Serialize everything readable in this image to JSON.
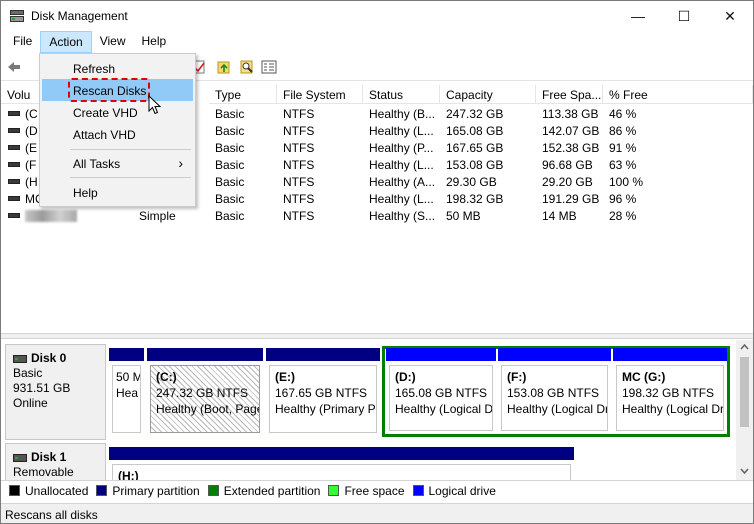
{
  "window": {
    "title": "Disk Management",
    "minimize_glyph": "—",
    "maximize_glyph": "☐",
    "close_glyph": "✕"
  },
  "menubar": {
    "items": [
      {
        "label": "File"
      },
      {
        "label": "Action",
        "active": true
      },
      {
        "label": "View"
      },
      {
        "label": "Help"
      }
    ]
  },
  "action_menu": {
    "items": [
      {
        "label": "Refresh"
      },
      {
        "label": "Rescan Disks",
        "hover": true
      },
      {
        "label": "Create VHD"
      },
      {
        "label": "Attach VHD"
      },
      {
        "label": "All Tasks",
        "submenu_glyph": "›"
      },
      {
        "label": "Help"
      }
    ]
  },
  "list": {
    "columns": [
      "Volu",
      "Type",
      "File System",
      "Status",
      "Capacity",
      "Free Spa...",
      "% Free"
    ],
    "rows": [
      {
        "volume": "(C",
        "layout": "",
        "type": "Basic",
        "fs": "NTFS",
        "status": "Healthy (B...",
        "capacity": "247.32 GB",
        "free": "113.38 GB",
        "pct": "46 %"
      },
      {
        "volume": "(D",
        "layout": "",
        "type": "Basic",
        "fs": "NTFS",
        "status": "Healthy (L...",
        "capacity": "165.08 GB",
        "free": "142.07 GB",
        "pct": "86 %"
      },
      {
        "volume": "(E",
        "layout": "",
        "type": "Basic",
        "fs": "NTFS",
        "status": "Healthy (P...",
        "capacity": "167.65 GB",
        "free": "152.38 GB",
        "pct": "91 %"
      },
      {
        "volume": "(F",
        "layout": "",
        "type": "Basic",
        "fs": "NTFS",
        "status": "Healthy (L...",
        "capacity": "153.08 GB",
        "free": "96.68 GB",
        "pct": "63 %"
      },
      {
        "volume": "(H",
        "layout": "",
        "type": "Basic",
        "fs": "NTFS",
        "status": "Healthy (A...",
        "capacity": "29.30 GB",
        "free": "29.20 GB",
        "pct": "100 %"
      },
      {
        "volume": "MC",
        "layout": "",
        "type": "Basic",
        "fs": "NTFS",
        "status": "Healthy (L...",
        "capacity": "198.32 GB",
        "free": "191.29 GB",
        "pct": "96 %"
      },
      {
        "volume": "",
        "layout": "Simple",
        "type": "Basic",
        "fs": "NTFS",
        "status": "Healthy (S...",
        "capacity": "50 MB",
        "free": "14 MB",
        "pct": "28 %"
      }
    ]
  },
  "disks": [
    {
      "name": "Disk 0",
      "type": "Basic",
      "size": "931.51 GB",
      "state": "Online",
      "partitions": [
        {
          "label": "",
          "line1": "50 M",
          "line2": "Hea"
        },
        {
          "label": "(C:)",
          "line1": "247.32 GB NTFS",
          "line2": "Healthy (Boot, Page"
        },
        {
          "label": "(E:)",
          "line1": "167.65 GB NTFS",
          "line2": "Healthy (Primary P"
        },
        {
          "label": "(D:)",
          "line1": "165.08 GB NTFS",
          "line2": "Healthy (Logical D"
        },
        {
          "label": "(F:)",
          "line1": "153.08 GB NTFS",
          "line2": "Healthy (Logical Dr"
        },
        {
          "label": "MC  (G:)",
          "line1": "198.32 GB NTFS",
          "line2": "Healthy (Logical Dr"
        }
      ]
    },
    {
      "name": "Disk 1",
      "type": "Removable",
      "partitions": [
        {
          "label": "(H:)"
        }
      ]
    }
  ],
  "legend": [
    {
      "label": "Unallocated",
      "color": "#000000"
    },
    {
      "label": "Primary partition",
      "color": "#000080"
    },
    {
      "label": "Extended partition",
      "color": "#008000"
    },
    {
      "label": "Free space",
      "color": "#33ff33"
    },
    {
      "label": "Logical drive",
      "color": "#0000ff"
    }
  ],
  "colors": {
    "primary_bar": "#000080",
    "logical_bar": "#0000ff",
    "extended_frame": "#008000",
    "highlight_dash": "#e00000"
  },
  "statusbar": {
    "text": "Rescans all disks"
  }
}
